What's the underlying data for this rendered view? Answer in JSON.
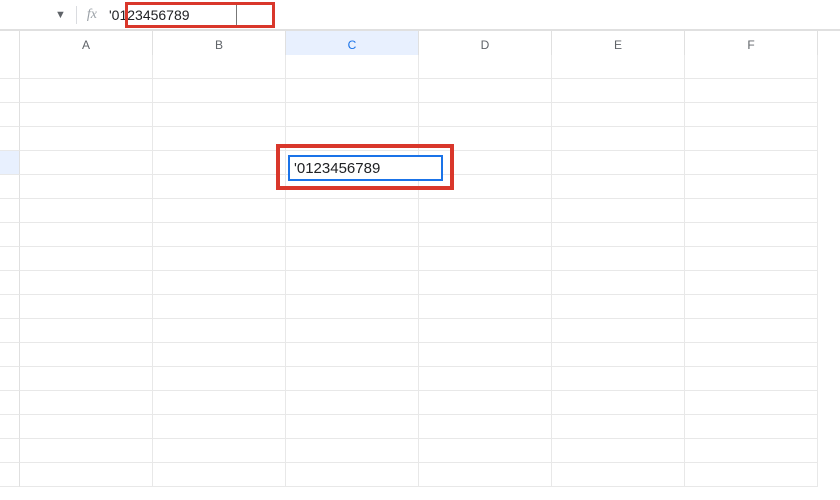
{
  "formula_bar": {
    "fx_label": "fx",
    "input_value": "'0123456789"
  },
  "columns": [
    "A",
    "B",
    "C",
    "D",
    "E",
    "F"
  ],
  "selected_column_index": 2,
  "selected_row_index": 4,
  "row_count": 18,
  "active_cell": {
    "col": 2,
    "row": 4,
    "display_value": "'0123456789"
  },
  "highlight_color": "#d9372b",
  "selection_color": "#1a73e8"
}
